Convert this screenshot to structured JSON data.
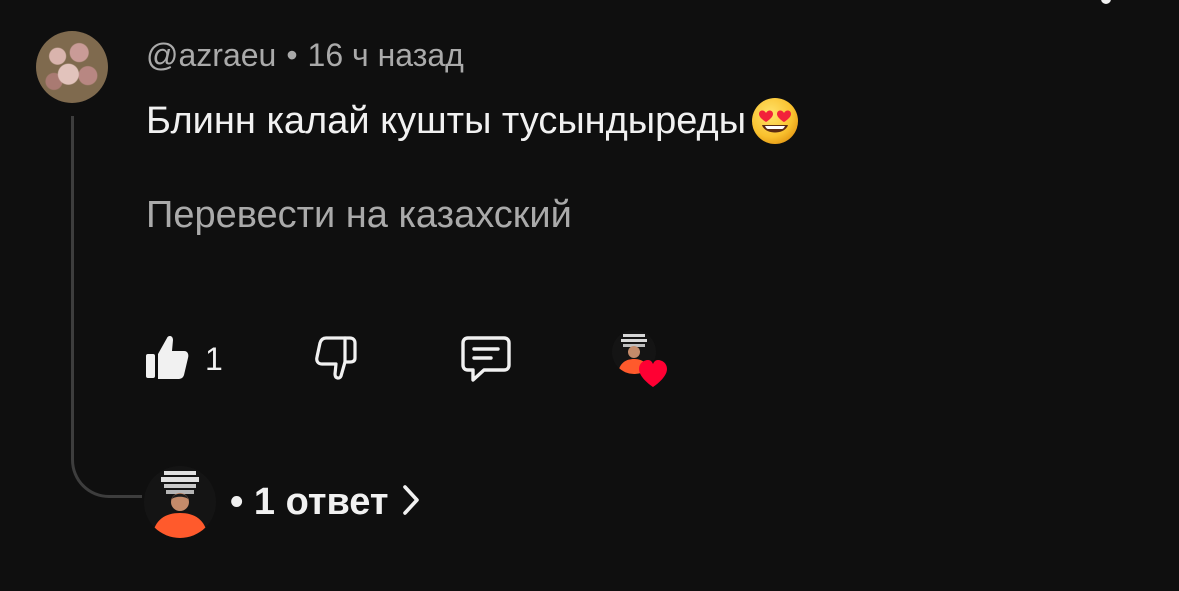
{
  "comment": {
    "author": "@azraeu",
    "separator": "•",
    "time": "16 ч назад",
    "text": "Блинн калай кушты тусындыреды",
    "emoji": "smiling-face-with-heart-eyes",
    "translate_label": "Перевести на казахский"
  },
  "actions": {
    "like_count": "1",
    "like_icon": "thumb-up-icon",
    "dislike_icon": "thumb-down-icon",
    "reply_icon": "reply-bubble-icon",
    "creator_heart_color": "#ff0033"
  },
  "replies": {
    "separator": "•",
    "label": "1 ответ"
  },
  "colors": {
    "background": "#0f0f0f",
    "primary_text": "#f1f1f1",
    "secondary_text": "#aaaaaa",
    "thread_line": "#3d3d3d",
    "shirt": "#ff5a2c"
  }
}
